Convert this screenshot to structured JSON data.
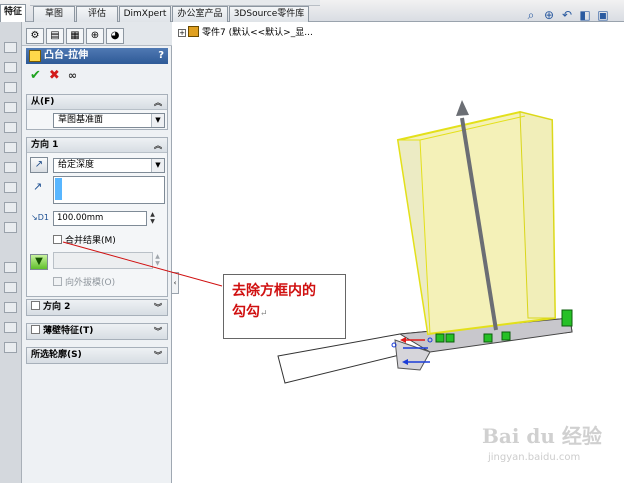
{
  "tabs": [
    {
      "label": "特征",
      "active": true
    },
    {
      "label": "草图"
    },
    {
      "label": "评估"
    },
    {
      "label": "DimXpert"
    },
    {
      "label": "办公室产品"
    },
    {
      "label": "3DSource零件库"
    }
  ],
  "view_tools": [
    "zoom-to-fit-icon",
    "zoom-area-icon",
    "previous-view-icon",
    "section-view-icon",
    "view-orientation-icon"
  ],
  "feature": {
    "title": "凸台-拉伸",
    "help": "?"
  },
  "from_group": {
    "title": "从(F)",
    "select_value": "草图基准面"
  },
  "direction1": {
    "title": "方向 1",
    "end_condition": "给定深度",
    "depth": "100.00mm",
    "merge_result": "合并结果(M)",
    "draft_outward": "向外拔模(O)"
  },
  "direction2": {
    "title": "方向 2"
  },
  "thin_feature": {
    "title": "薄壁特征(T)"
  },
  "contours": {
    "title": "所选轮廓(S)"
  },
  "tree": {
    "item": "零件7  (默认<<默认>_显..."
  },
  "callout": {
    "line1": "去除方框内的",
    "line2": "勾勾",
    "mark": "↵"
  },
  "watermark": {
    "brand": "Bai du 经验",
    "url": "jingyan.baidu.com"
  },
  "colors": {
    "extrude_face": "#f4f1b8",
    "extrude_edge": "#e3e01a",
    "handle_green": "#26c026",
    "arrow_red": "#e01a1a",
    "arrow_blue": "#1a3cd8",
    "callout_line": "#d01010"
  }
}
